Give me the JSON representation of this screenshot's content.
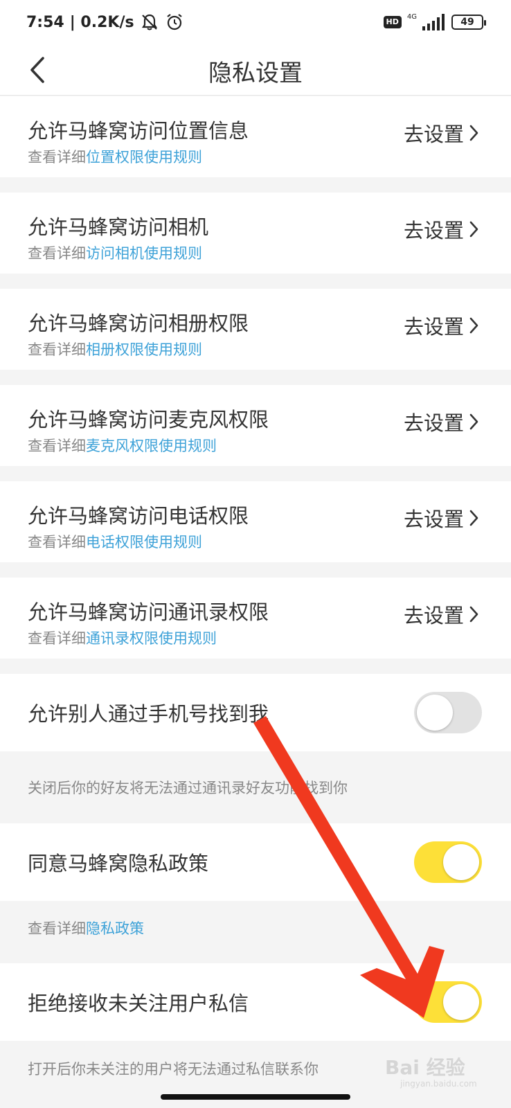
{
  "status": {
    "time": "7:54",
    "speed": "| 0.2K/s",
    "hd": "HD",
    "network": "4G",
    "battery": "49"
  },
  "header": {
    "title": "隐私设置"
  },
  "permissions": [
    {
      "title": "允许马蜂窝访问位置信息",
      "prefix": "查看详细",
      "link": "位置权限使用规则",
      "action": "去设置"
    },
    {
      "title": "允许马蜂窝访问相机",
      "prefix": "查看详细",
      "link": "访问相机使用规则",
      "action": "去设置"
    },
    {
      "title": "允许马蜂窝访问相册权限",
      "prefix": "查看详细",
      "link": "相册权限使用规则",
      "action": "去设置"
    },
    {
      "title": "允许马蜂窝访问麦克风权限",
      "prefix": "查看详细",
      "link": "麦克风权限使用规则",
      "action": "去设置"
    },
    {
      "title": "允许马蜂窝访问电话权限",
      "prefix": "查看详细",
      "link": "电话权限使用规则",
      "action": "去设置"
    },
    {
      "title": "允许马蜂窝访问通讯录权限",
      "prefix": "查看详细",
      "link": "通讯录权限使用规则",
      "action": "去设置"
    }
  ],
  "toggles": [
    {
      "label": "允许别人通过手机号找到我",
      "on": false,
      "note_text": "关闭后你的好友将无法通过通讯录好友功能找到你",
      "note_link": ""
    },
    {
      "label": "同意马蜂窝隐私政策",
      "on": true,
      "note_text": "查看详细",
      "note_link": "隐私政策"
    },
    {
      "label": "拒绝接收未关注用户私信",
      "on": true,
      "note_text": "打开后你未关注的用户将无法通过私信联系你",
      "note_link": ""
    }
  ],
  "colors": {
    "accent_link": "#3ea2d8",
    "toggle_on": "#fde038",
    "toggle_off": "#e2e2e2",
    "annotation_arrow": "#f0391f"
  },
  "watermark": {
    "main": "Bai 经验",
    "sub": "jingyan.baidu.com"
  }
}
